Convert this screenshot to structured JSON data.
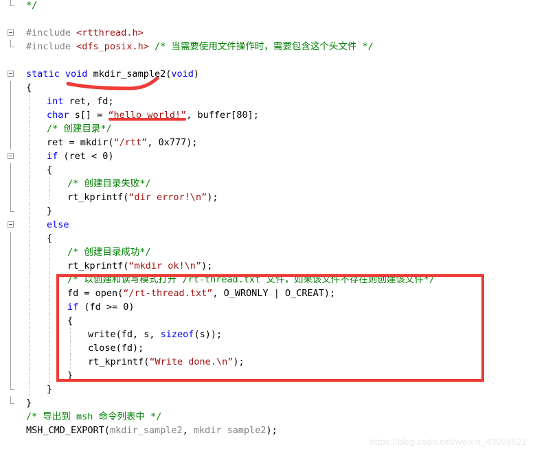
{
  "editor": {
    "language": "C",
    "colors": {
      "keyword": "#0000ff",
      "comment": "#008000",
      "string": "#a31515",
      "include": "#a31515",
      "plain": "#000000",
      "macro_arg": "#808080",
      "annotation_red": "#ef3b36",
      "background": "#ffffff",
      "indent_guide": "#c4c4c4",
      "fold_line": "#a0a0a0"
    },
    "lines": [
      {
        "n": 1,
        "fold": "end",
        "indent": 0,
        "text": "*/"
      },
      {
        "n": 2,
        "fold": "none",
        "indent": 0,
        "text": ""
      },
      {
        "n": 3,
        "fold": "open",
        "indent": 0,
        "text": "#include <rtthread.h>"
      },
      {
        "n": 4,
        "fold": "end",
        "indent": 0,
        "text": "#include <dfs_posix.h> /* 当需要使用文件操作时，需要包含这个头文件 */"
      },
      {
        "n": 5,
        "fold": "none",
        "indent": 0,
        "text": ""
      },
      {
        "n": 6,
        "fold": "open",
        "indent": 0,
        "text": "static void mkdir_sample2(void)"
      },
      {
        "n": 7,
        "fold": "line",
        "indent": 0,
        "text": "{"
      },
      {
        "n": 8,
        "fold": "line",
        "indent": 1,
        "text": "int ret, fd;"
      },
      {
        "n": 9,
        "fold": "line",
        "indent": 1,
        "text": "char s[] = “hello world!”, buffer[80];"
      },
      {
        "n": 10,
        "fold": "line",
        "indent": 1,
        "text": "/* 创建目录*/"
      },
      {
        "n": 11,
        "fold": "line",
        "indent": 1,
        "text": "ret = mkdir(“/rtt”, 0x777);"
      },
      {
        "n": 12,
        "fold": "open",
        "indent": 1,
        "text": "if (ret < 0)"
      },
      {
        "n": 13,
        "fold": "line",
        "indent": 1,
        "text": "{"
      },
      {
        "n": 14,
        "fold": "line",
        "indent": 2,
        "text": "/* 创建目录失败*/"
      },
      {
        "n": 15,
        "fold": "line",
        "indent": 2,
        "text": "rt_kprintf(“dir error!\\n”);"
      },
      {
        "n": 16,
        "fold": "end",
        "indent": 1,
        "text": "}"
      },
      {
        "n": 17,
        "fold": "open",
        "indent": 1,
        "text": "else"
      },
      {
        "n": 18,
        "fold": "line",
        "indent": 1,
        "text": "{"
      },
      {
        "n": 19,
        "fold": "line",
        "indent": 2,
        "text": "/* 创建目录成功*/"
      },
      {
        "n": 20,
        "fold": "line",
        "indent": 2,
        "text": "rt_kprintf(“mkdir ok!\\n”);"
      },
      {
        "n": 21,
        "fold": "line",
        "indent": 2,
        "text": "/* 以创建和读写模式打开 /rt-thread.txt 文件，如果该文件不存在则创建该文件*/"
      },
      {
        "n": 22,
        "fold": "line",
        "indent": 2,
        "text": "fd = open(“/rt-thread.txt”, O_WRONLY | O_CREAT);"
      },
      {
        "n": 23,
        "fold": "line",
        "indent": 2,
        "text": "if (fd >= 0)"
      },
      {
        "n": 24,
        "fold": "line",
        "indent": 2,
        "text": "{"
      },
      {
        "n": 25,
        "fold": "line",
        "indent": 3,
        "text": "write(fd, s, sizeof(s));"
      },
      {
        "n": 26,
        "fold": "line",
        "indent": 3,
        "text": "close(fd);"
      },
      {
        "n": 27,
        "fold": "line",
        "indent": 3,
        "text": "rt_kprintf(“Write done.\\n”);"
      },
      {
        "n": 28,
        "fold": "line",
        "indent": 2,
        "text": "}"
      },
      {
        "n": 29,
        "fold": "end",
        "indent": 1,
        "text": "}"
      },
      {
        "n": 30,
        "fold": "end",
        "indent": 0,
        "text": "}"
      },
      {
        "n": 31,
        "fold": "none",
        "indent": 0,
        "text": "/* 导出到 msh 命令列表中 */"
      },
      {
        "n": 32,
        "fold": "none",
        "indent": 0,
        "text": "MSH_CMD_EXPORT(mkdir_sample2, mkdir sample2);"
      }
    ]
  },
  "annotations": {
    "underline_function": {
      "label": "mkdir_sample2",
      "shape": "hand-drawn-swoosh",
      "color": "#ef3b36"
    },
    "underline_string": {
      "label": "“hello world!”",
      "shape": "straight-line",
      "color": "#ef3b36"
    },
    "highlight_box": {
      "label": "file open / write / close block",
      "shape": "rectangle",
      "color": "#ef3b36"
    }
  },
  "watermark": {
    "text": "https://blog.csdn.net/weixin_43058521"
  }
}
